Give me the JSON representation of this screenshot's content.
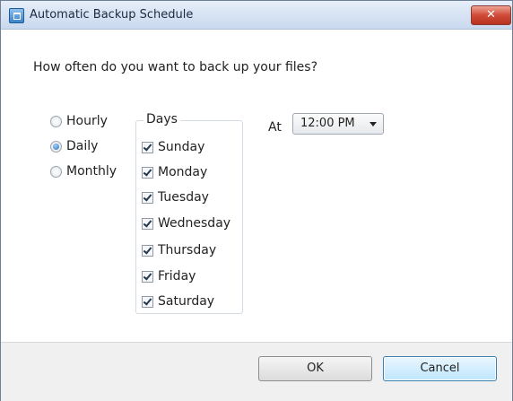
{
  "window": {
    "title": "Automatic Backup Schedule",
    "close_label": "✕"
  },
  "question": "How often do you want to back up your files?",
  "frequency": {
    "options": [
      {
        "label": "Hourly",
        "checked": false
      },
      {
        "label": "Daily",
        "checked": true
      },
      {
        "label": "Monthly",
        "checked": false
      }
    ]
  },
  "days": {
    "legend": "Days",
    "items": [
      {
        "label": "Sunday",
        "checked": true
      },
      {
        "label": "Monday",
        "checked": true
      },
      {
        "label": "Tuesday",
        "checked": true
      },
      {
        "label": "Wednesday",
        "checked": true
      },
      {
        "label": "Thursday",
        "checked": true
      },
      {
        "label": "Friday",
        "checked": true
      },
      {
        "label": "Saturday",
        "checked": true
      }
    ]
  },
  "time": {
    "at_label": "At",
    "selected": "12:00 PM"
  },
  "buttons": {
    "ok_label": "OK",
    "cancel_label": "Cancel"
  },
  "colors": {
    "accent": "#2b6fb6",
    "close_button": "#cf4b38",
    "footer_bg": "#f0f0f0"
  }
}
